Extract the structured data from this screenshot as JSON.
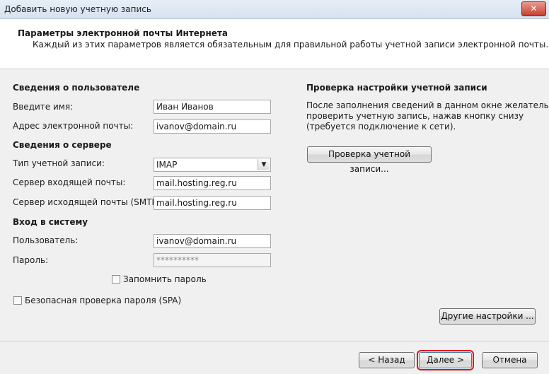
{
  "window": {
    "title": "Добавить новую учетную запись",
    "close_label": "✕"
  },
  "header": {
    "title": "Параметры электронной почты Интернета",
    "subtitle": "Каждый из этих параметров является обязательным для правильной работы учетной записи электронной почты."
  },
  "user_info": {
    "heading": "Сведения о пользователе",
    "name_label": "Введите имя:",
    "name_value": "Иван Иванов",
    "email_label": "Адрес электронной почты:",
    "email_value": "ivanov@domain.ru"
  },
  "server_info": {
    "heading": "Сведения о сервере",
    "account_type_label": "Тип учетной записи:",
    "account_type_value": "IMAP",
    "incoming_label": "Сервер входящей почты:",
    "incoming_value": "mail.hosting.reg.ru",
    "outgoing_label": "Сервер исходящей почты (SMTP):",
    "outgoing_value": "mail.hosting.reg.ru"
  },
  "login": {
    "heading": "Вход в систему",
    "user_label": "Пользователь:",
    "user_value": "ivanov@domain.ru",
    "password_label": "Пароль:",
    "password_value": "**********",
    "remember_label": "Запомнить пароль",
    "remember_checked": false,
    "spa_label": "Безопасная проверка пароля (SPA)",
    "spa_checked": false
  },
  "test": {
    "heading": "Проверка настройки учетной записи",
    "description_lines": [
      "После заполнения сведений в данном окне желательно",
      "проверить учетную запись, нажав кнопку снизу",
      "(требуется подключение к сети)."
    ],
    "test_button": "Проверка учетной записи..."
  },
  "buttons": {
    "more_settings": "Другие настройки ...",
    "back": "< Назад",
    "next": "Далее >",
    "cancel": "Отмена"
  }
}
